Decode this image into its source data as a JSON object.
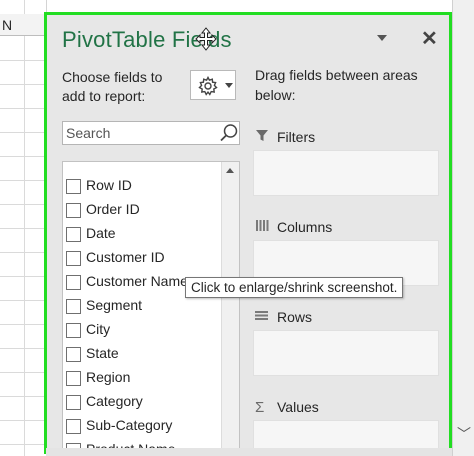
{
  "sheet": {
    "column_header": "N"
  },
  "pane": {
    "title": "PivotTable Fields",
    "choose_text_line1": "Choose fields to",
    "choose_text_line2": "add to report:",
    "tools_icon": "gear-icon",
    "search_placeholder": "Search",
    "drag_text_line1": "Drag fields between areas",
    "drag_text_line2": "below:",
    "fields": [
      "Row ID",
      "Order ID",
      "Date",
      "Customer ID",
      "Customer Name",
      "Segment",
      "City",
      "State",
      "Region",
      "Category",
      "Sub-Category",
      "Product Name"
    ],
    "areas": {
      "filters": "Filters",
      "columns": "Columns",
      "rows": "Rows",
      "values": "Values"
    }
  },
  "tooltip": {
    "text": "Click to enlarge/shrink screenshot."
  },
  "colors": {
    "accent": "#217346",
    "highlight_border": "#22dd22"
  }
}
